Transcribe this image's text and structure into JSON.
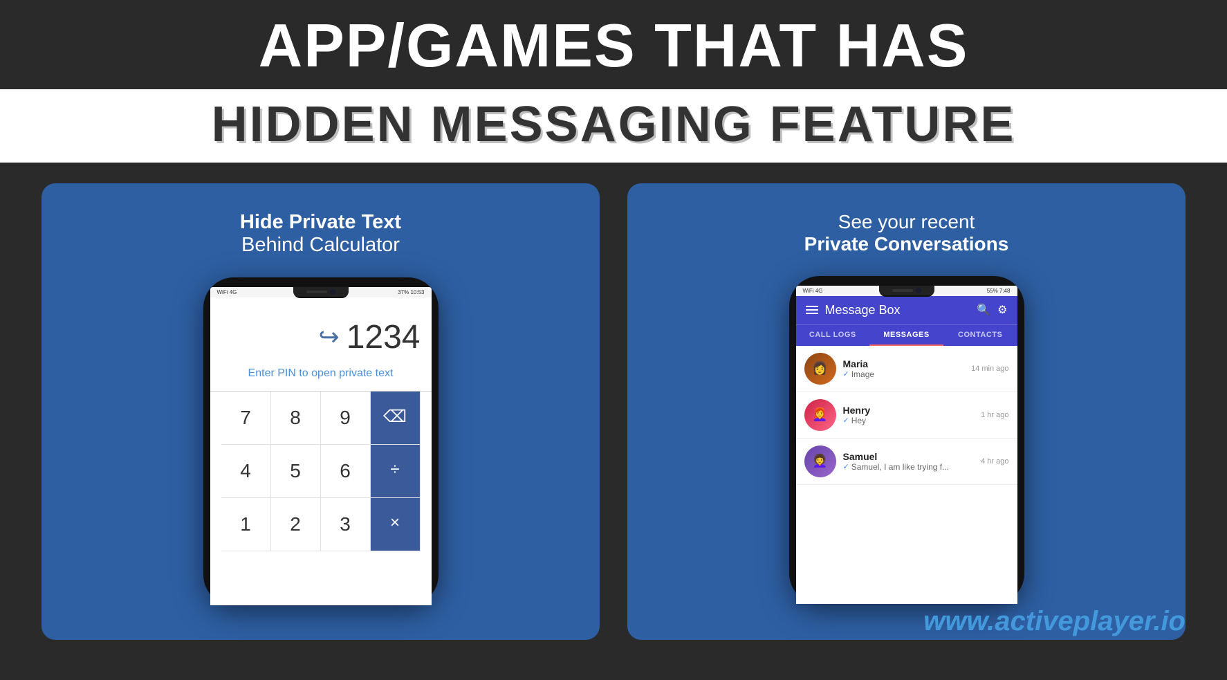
{
  "header": {
    "line1": "APP/GAMES THAT HAS",
    "line2": "HIDDEN MESSAGING FEATURE"
  },
  "leftCard": {
    "caption_line1": "Hide Private Text",
    "caption_line2": "Behind Calculator",
    "phone": {
      "status_left": "WiFi 4G",
      "status_right": "37% 10:53",
      "display_number": "1234",
      "hint": "Enter PIN to open private text",
      "buttons": [
        {
          "label": "7",
          "type": "num"
        },
        {
          "label": "8",
          "type": "num"
        },
        {
          "label": "9",
          "type": "num"
        },
        {
          "label": "⌫",
          "type": "op"
        },
        {
          "label": "4",
          "type": "num"
        },
        {
          "label": "5",
          "type": "num"
        },
        {
          "label": "6",
          "type": "num"
        },
        {
          "label": "÷",
          "type": "op"
        },
        {
          "label": "1",
          "type": "num"
        },
        {
          "label": "2",
          "type": "num"
        },
        {
          "label": "3",
          "type": "num"
        },
        {
          "label": "×",
          "type": "op"
        }
      ]
    }
  },
  "rightCard": {
    "caption_line1": "See your recent",
    "caption_line2": "Private Conversations",
    "phone": {
      "status_left": "WiFi 4G",
      "status_right": "55% 7:48",
      "header_title": "Message Box",
      "tabs": [
        {
          "label": "CALL LOGS",
          "active": false
        },
        {
          "label": "MESSAGES",
          "active": true
        },
        {
          "label": "CONTACTS",
          "active": false
        }
      ],
      "messages": [
        {
          "name": "Maria",
          "preview": "Image",
          "time": "14 min ago",
          "avatar": "maria"
        },
        {
          "name": "Henry",
          "preview": "Hey",
          "time": "1 hr ago",
          "avatar": "henry"
        },
        {
          "name": "Samuel",
          "preview": "Samuel, I am like trying f...",
          "time": "4 hr ago",
          "avatar": "samuel"
        }
      ]
    }
  },
  "branding": {
    "url": "www.activeplayer.io"
  }
}
